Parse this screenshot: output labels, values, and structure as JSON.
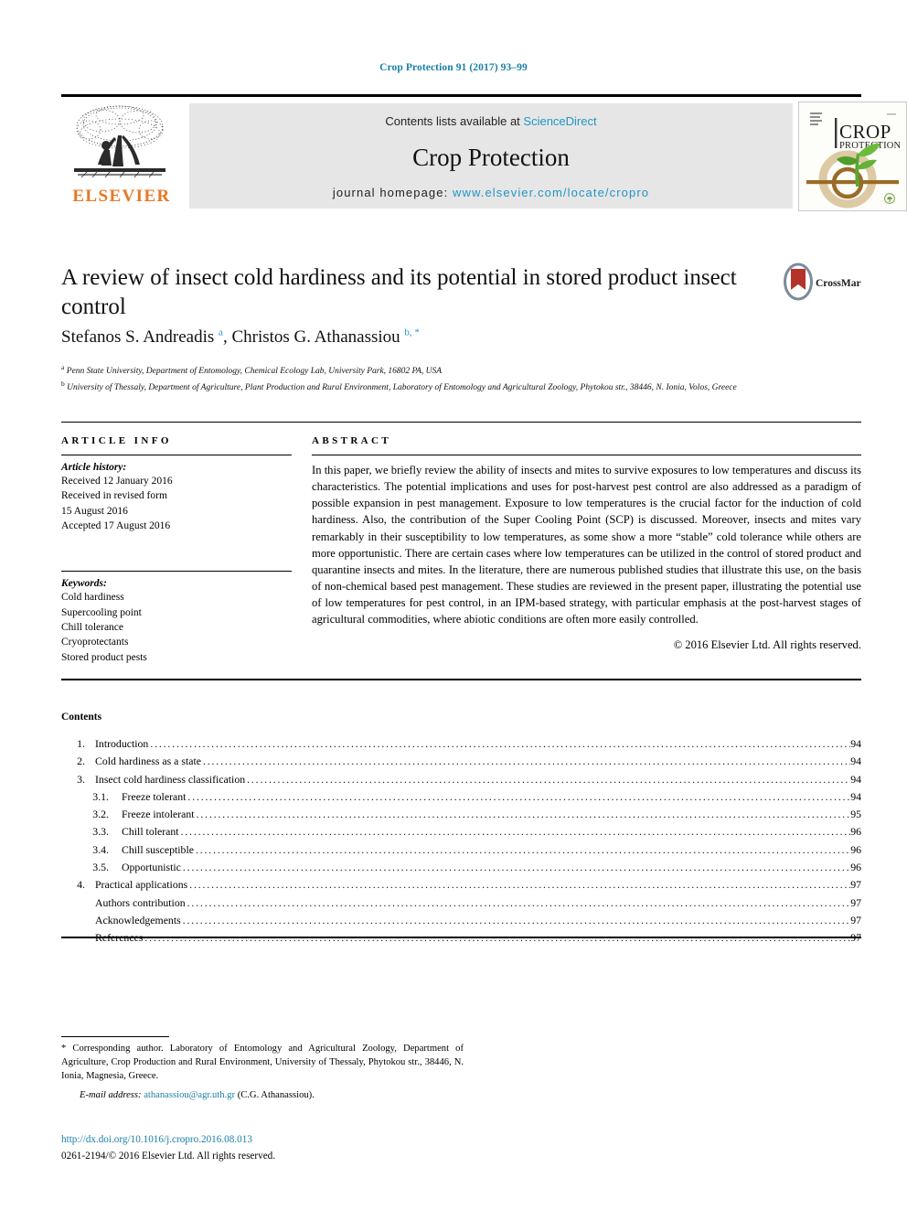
{
  "running_head": "Crop Protection 91 (2017) 93–99",
  "masthead": {
    "publisher": "ELSEVIER",
    "contents_prefix": "Contents lists available at ",
    "contents_link": "ScienceDirect",
    "journal_title": "Crop Protection",
    "homepage_prefix": "journal homepage: ",
    "homepage_url": "www.elsevier.com/locate/cropro",
    "cover_title_line1": "CROP",
    "cover_title_line2": "PROTECTION"
  },
  "article": {
    "title": "A review of insect cold hardiness and its potential in stored product insect control",
    "crossmark_label": "CrossMark",
    "authors_html": "Stefanos S. Andreadis <sup>a</sup>, Christos G. Athanassiou <sup>b, *</sup>",
    "affiliations": [
      {
        "marker": "a",
        "text": "Penn State University, Department of Entomology, Chemical Ecology Lab, University Park, 16802 PA, USA"
      },
      {
        "marker": "b",
        "text": "University of Thessaly, Department of Agriculture, Plant Production and Rural Environment, Laboratory of Entomology and Agricultural Zoology, Phytokou str., 38446, N. Ionia, Volos, Greece"
      }
    ]
  },
  "article_info": {
    "heading": "ARTICLE INFO",
    "history_label": "Article history:",
    "history_lines": [
      "Received 12 January 2016",
      "Received in revised form",
      "15 August 2016",
      "Accepted 17 August 2016"
    ],
    "keywords_label": "Keywords:",
    "keywords": [
      "Cold hardiness",
      "Supercooling point",
      "Chill tolerance",
      "Cryoprotectants",
      "Stored product pests"
    ]
  },
  "abstract": {
    "heading": "ABSTRACT",
    "body": "In this paper, we briefly review the ability of insects and mites to survive exposures to low temperatures and discuss its characteristics. The potential implications and uses for post-harvest pest control are also addressed as a paradigm of possible expansion in pest management. Exposure to low temperatures is the crucial factor for the induction of cold hardiness. Also, the contribution of the Super Cooling Point (SCP) is discussed. Moreover, insects and mites vary remarkably in their susceptibility to low temperatures, as some show a more “stable” cold tolerance while others are more opportunistic. There are certain cases where low temperatures can be utilized in the control of stored product and quarantine insects and mites. In the literature, there are numerous published studies that illustrate this use, on the basis of non-chemical based pest management. These studies are reviewed in the present paper, illustrating the potential use of low temperatures for pest control, in an IPM-based strategy, with particular emphasis at the post-harvest stages of agricultural commodities, where abiotic conditions are often more easily controlled.",
    "copyright": "© 2016 Elsevier Ltd. All rights reserved."
  },
  "contents": {
    "heading": "Contents",
    "entries": [
      {
        "num": "1.",
        "label": "Introduction",
        "page": "94",
        "sub": false
      },
      {
        "num": "2.",
        "label": "Cold hardiness as a state",
        "page": "94",
        "sub": false
      },
      {
        "num": "3.",
        "label": "Insect cold hardiness classification",
        "page": "94",
        "sub": false
      },
      {
        "num": "3.1.",
        "label": "Freeze tolerant",
        "page": "94",
        "sub": true
      },
      {
        "num": "3.2.",
        "label": "Freeze intolerant",
        "page": "95",
        "sub": true
      },
      {
        "num": "3.3.",
        "label": "Chill tolerant",
        "page": "96",
        "sub": true
      },
      {
        "num": "3.4.",
        "label": "Chill susceptible",
        "page": "96",
        "sub": true
      },
      {
        "num": "3.5.",
        "label": "Opportunistic",
        "page": "96",
        "sub": true
      },
      {
        "num": "4.",
        "label": "Practical applications",
        "page": "97",
        "sub": false
      },
      {
        "num": "",
        "label": "Authors contribution",
        "page": "97",
        "sub": false
      },
      {
        "num": "",
        "label": "Acknowledgements",
        "page": "97",
        "sub": false
      },
      {
        "num": "",
        "label": "References",
        "page": "97",
        "sub": false
      }
    ]
  },
  "footer": {
    "corresponding_note": "* Corresponding author. Laboratory of Entomology and Agricultural Zoology, Department of Agriculture, Crop Production and Rural Environment, University of Thessaly, Phytokou str., 38446, N. Ionia, Magnesia, Greece.",
    "email_label": "E-mail address:",
    "email": "athanassiou@agr.uth.gr",
    "email_owner": "(C.G. Athanassiou).",
    "doi": "http://dx.doi.org/10.1016/j.cropro.2016.08.013",
    "copyright": "0261-2194/© 2016 Elsevier Ltd. All rights reserved."
  },
  "colors": {
    "link_blue": "#1a7fa8",
    "sciencedirect_blue": "#2196c4",
    "elsevier_orange": "#E87722",
    "banner_grey": "#e6e6e6",
    "crossmark_red": "#b5332a"
  }
}
